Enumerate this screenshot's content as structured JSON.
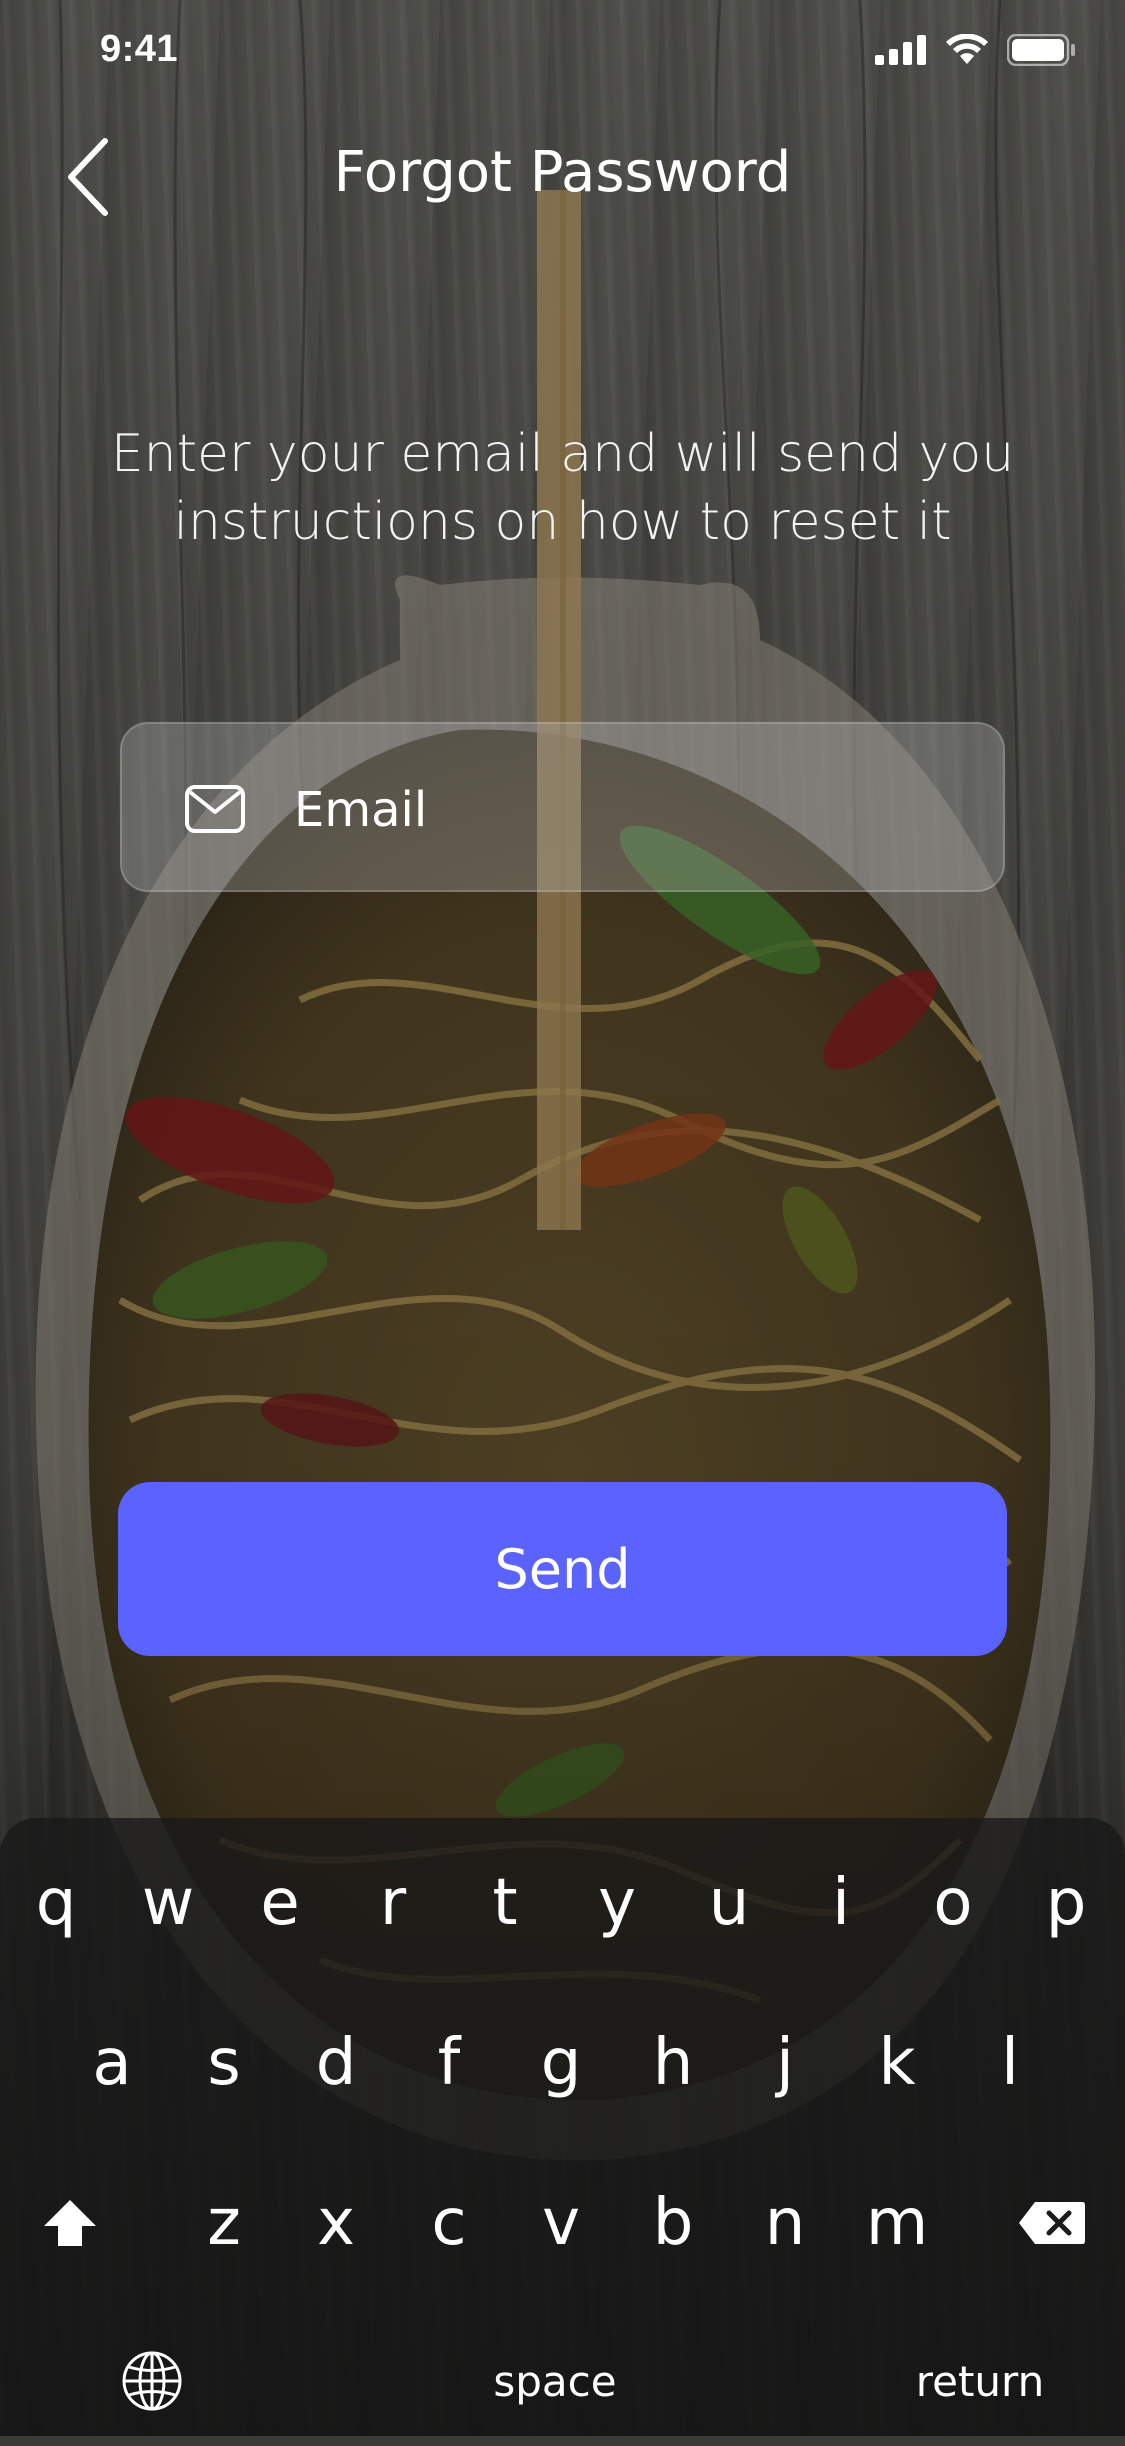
{
  "status_bar": {
    "time": "9:41",
    "icons": [
      "signal-icon",
      "wifi-icon",
      "battery-icon"
    ]
  },
  "nav": {
    "title": "Forgot Password",
    "back_icon": "chevron-left-icon"
  },
  "instructions": "Enter your email and will send you instructions on how to reset it",
  "email_field": {
    "icon": "mail-icon",
    "value": "",
    "placeholder": "Email"
  },
  "send_button": {
    "label": "Send",
    "color": "#5b63ff"
  },
  "keyboard": {
    "row1": [
      "q",
      "w",
      "e",
      "r",
      "t",
      "y",
      "u",
      "i",
      "o",
      "p"
    ],
    "row2": [
      "a",
      "s",
      "d",
      "f",
      "g",
      "h",
      "j",
      "k",
      "l"
    ],
    "row3": [
      "z",
      "x",
      "c",
      "v",
      "b",
      "n",
      "m"
    ],
    "shift_icon": "shift-icon",
    "delete_icon": "delete-icon",
    "globe_icon": "globe-icon",
    "space_label": "space",
    "return_label": "return"
  }
}
